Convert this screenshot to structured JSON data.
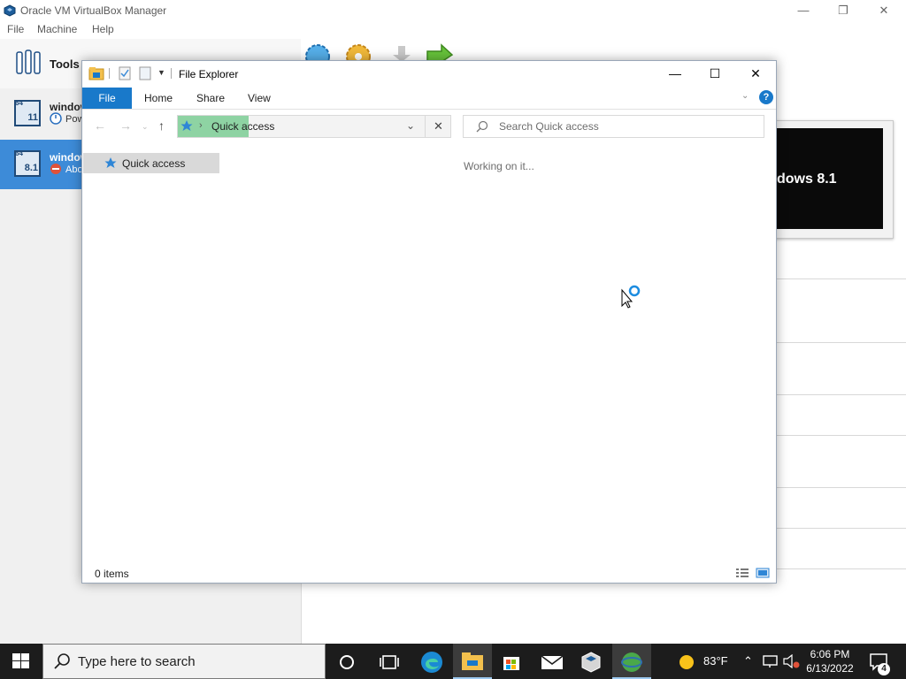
{
  "vbox": {
    "title": "Oracle VM VirtualBox Manager",
    "menu": [
      "File",
      "Machine",
      "Help"
    ],
    "tools_label": "Tools",
    "vms": [
      {
        "name": "window",
        "state": "Pow",
        "badge": "11",
        "bits": "64"
      },
      {
        "name": "window",
        "state": "Abo",
        "badge": "8.1",
        "bits": "64"
      }
    ],
    "preview_text": "dows 8.1"
  },
  "explorer": {
    "title": "File Explorer",
    "tabs": {
      "file": "File",
      "home": "Home",
      "share": "Share",
      "view": "View"
    },
    "address": "Quick access",
    "search_placeholder": "Search Quick access",
    "nav_item": "Quick access",
    "working": "Working on it...",
    "status": "0 items",
    "help": "?"
  },
  "taskbar": {
    "search_placeholder": "Type here to search",
    "temperature": "83°F",
    "time": "6:06 PM",
    "date": "6/13/2022",
    "notifications": "4"
  },
  "colors": {
    "accent": "#1979ca",
    "selected_vm": "#3d8bd8",
    "address_highlight": "#8ed3a3",
    "taskbar": "#1c1c1c"
  }
}
